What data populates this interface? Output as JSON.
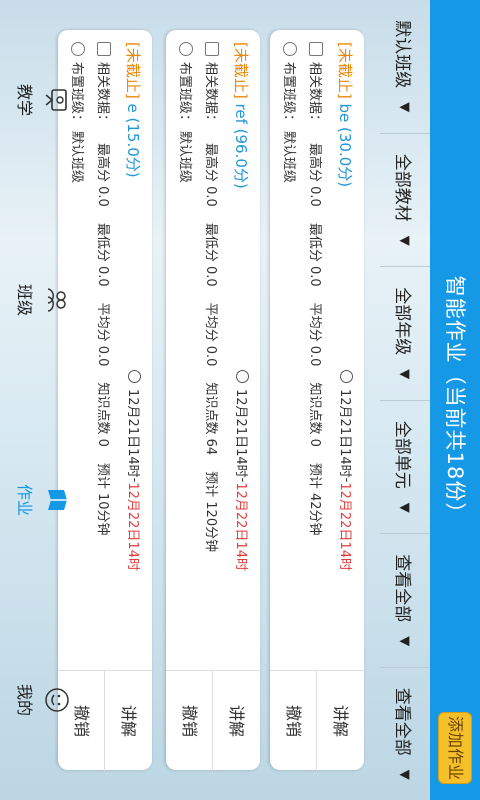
{
  "header": {
    "title": "智能作业（当前共18份）",
    "add_button": "添加作业"
  },
  "filters": [
    {
      "label": "默认班级"
    },
    {
      "label": "全部教材"
    },
    {
      "label": "全部年级"
    },
    {
      "label": "全部单元"
    },
    {
      "label": "查看全部"
    },
    {
      "label": "查看全部"
    }
  ],
  "cards": [
    {
      "tag": "[未截止]",
      "name": "be",
      "score": "(30.0分)",
      "stats_label": "相关数据：",
      "max": "最高分 0.0",
      "min": "最低分 0.0",
      "avg": "平均分 0.0",
      "knowledge": "知识点数 0",
      "estimate": "预计 42分钟",
      "class_label": "布置班级：",
      "class": "默认班级",
      "time_start": "12月21日14时",
      "time_sep": " - ",
      "time_end": "12月22日14时",
      "action1": "讲解",
      "action2": "撤销"
    },
    {
      "tag": "[未截止]",
      "name": "ref",
      "score": "(96.0分)",
      "stats_label": "相关数据：",
      "max": "最高分 0.0",
      "min": "最低分 0.0",
      "avg": "平均分 0.0",
      "knowledge": "知识点数 64",
      "estimate": "预计 120分钟",
      "class_label": "布置班级：",
      "class": "默认班级",
      "time_start": "12月21日14时",
      "time_sep": " - ",
      "time_end": "12月22日14时",
      "action1": "讲解",
      "action2": "撤销"
    },
    {
      "tag": "[未截止]",
      "name": "e",
      "score": "(15.0分)",
      "stats_label": "相关数据：",
      "max": "最高分 0.0",
      "min": "最低分 0.0",
      "avg": "平均分 0.0",
      "knowledge": "知识点数 0",
      "estimate": "预计 10分钟",
      "class_label": "布置班级：",
      "class": "默认班级",
      "time_start": "12月21日14时",
      "time_sep": " - ",
      "time_end": "12月22日14时",
      "action1": "讲解",
      "action2": "撤销"
    }
  ],
  "nav": [
    {
      "label": "教学",
      "icon": "teaching-icon"
    },
    {
      "label": "班级",
      "icon": "class-icon"
    },
    {
      "label": "作业",
      "icon": "homework-icon"
    },
    {
      "label": "我的",
      "icon": "profile-icon"
    }
  ],
  "colors": {
    "header": "#1598e6",
    "tag": "#e8890c",
    "title": "#2196d6",
    "deadline": "#e23c3c",
    "add_button": "#f5c02a"
  }
}
